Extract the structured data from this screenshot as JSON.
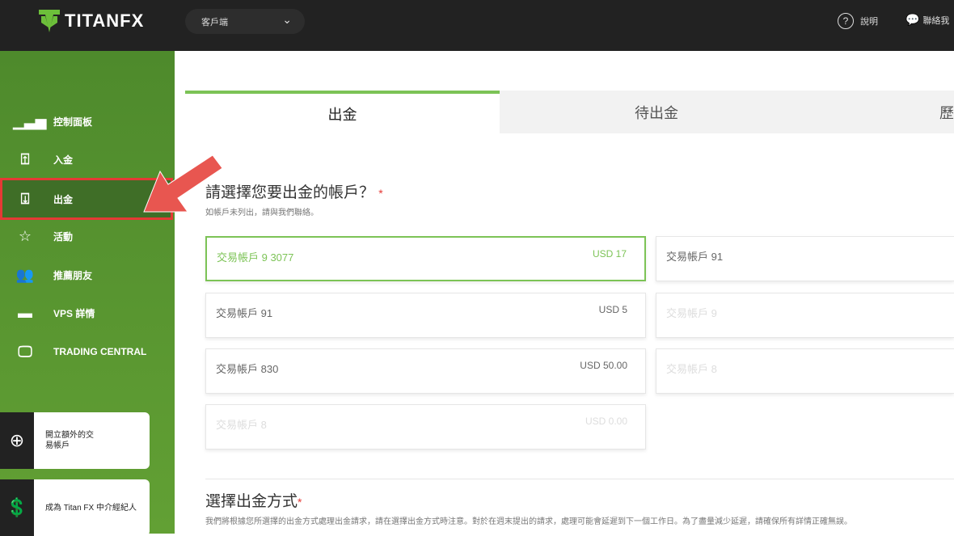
{
  "header": {
    "logo": "TITANFX",
    "portal_select": "客戶端",
    "help": "說明",
    "contact": "聯絡我"
  },
  "sidebar": {
    "items": [
      {
        "label": "控制面板",
        "icon": "bar-chart-icon"
      },
      {
        "label": "入金",
        "icon": "deposit-icon"
      },
      {
        "label": "出金",
        "icon": "withdraw-icon"
      },
      {
        "label": "活動",
        "icon": "promotion-icon"
      },
      {
        "label": "推薦朋友",
        "icon": "refer-friend-icon"
      },
      {
        "label": "VPS 詳情",
        "icon": "server-icon"
      },
      {
        "label": "TRADING CENTRAL",
        "icon": "monitor-chart-icon"
      }
    ],
    "cards": [
      {
        "label": "開立額外的交易帳戶",
        "icon": "plus-circle-icon"
      },
      {
        "label": "成為 Titan FX 中介經紀人",
        "icon": "dollar-chat-icon"
      }
    ]
  },
  "tabs": [
    "出金",
    "待出金",
    "歷"
  ],
  "section1": {
    "title": "請選擇您要出金的帳戶？",
    "required": "*",
    "hint": "如帳戶未列出，請與我們聯絡。"
  },
  "accounts": [
    {
      "name": "交易帳戶 9 3077",
      "balance": "USD 17"
    },
    {
      "name": "交易帳戶 91",
      "balance": ""
    },
    {
      "name": "交易帳戶 91",
      "balance": "USD 5"
    },
    {
      "name": "交易帳戶 9",
      "balance": ""
    },
    {
      "name": "交易帳戶 830",
      "balance": "USD 50.00"
    },
    {
      "name": "交易帳戶 8",
      "balance": ""
    },
    {
      "name": "交易帳戶 8",
      "balance": "USD 0.00"
    }
  ],
  "section2": {
    "title": "選擇出金方式",
    "required": "*",
    "hint": "我們將根據您所選擇的出金方式處理出金請求，請在選擇出金方式時注意。對於在週末提出的請求，處理可能會延遲到下一個工作日。為了盡量減少延遲，請確保所有詳情正確無誤。"
  },
  "colors": {
    "accent": "#7cc356",
    "topbar": "#222222",
    "annotation": "#e53935"
  }
}
